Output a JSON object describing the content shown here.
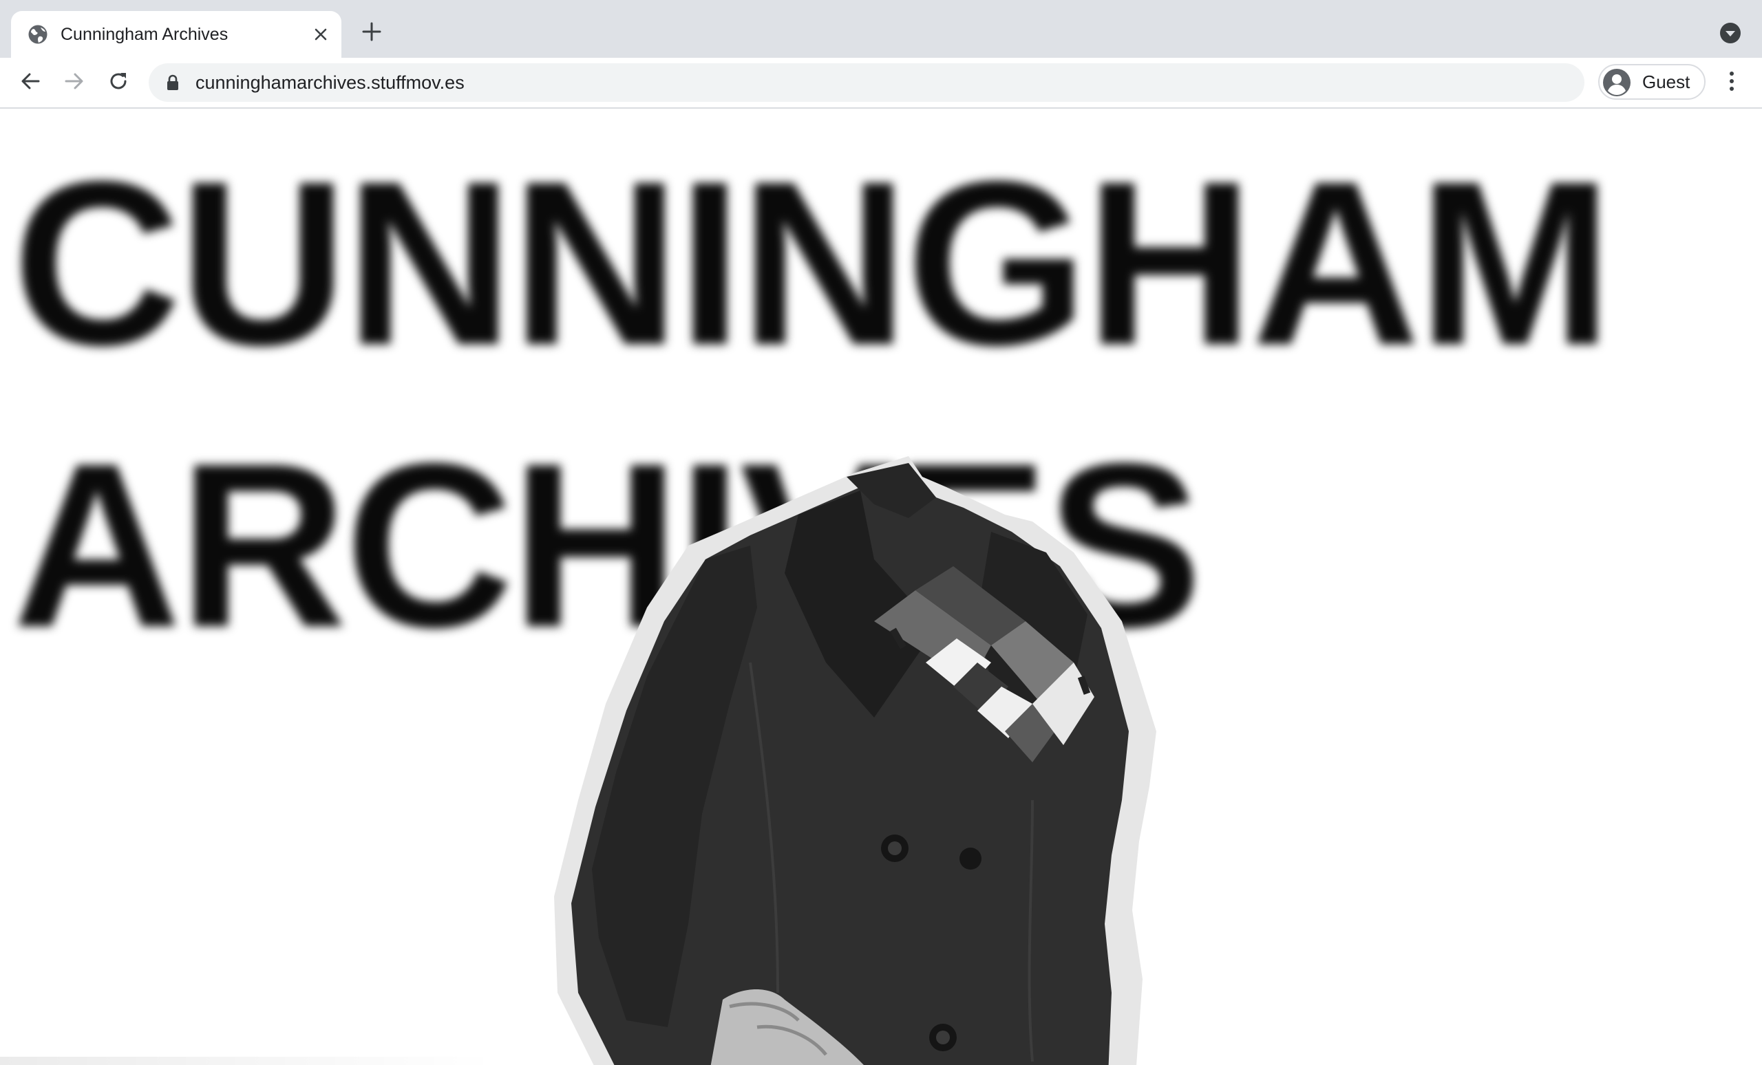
{
  "browser": {
    "tab": {
      "title": "Cunningham Archives",
      "favicon": "globe-icon"
    },
    "new_tab_icon": "plus-icon",
    "tab_search_icon": "chevron-down-circle-icon",
    "toolbar": {
      "back_icon": "arrow-left-icon",
      "forward_icon": "arrow-right-icon",
      "reload_icon": "reload-icon",
      "lock_icon": "lock-icon",
      "url": "cunninghamarchives.stuffmov.es",
      "profile_label": "Guest",
      "menu_icon": "three-dots-vertical-icon"
    }
  },
  "page": {
    "title_line_1": "CUNNINGHAM",
    "title_line_2": "ARCHIVES",
    "image": "black-and-white cutout photo of a headless figure in a dark double-breasted coat with a striped scarf"
  },
  "colors": {
    "tabstrip_bg": "#dee1e6",
    "omnibox_bg": "#f1f3f4",
    "text": "#202124",
    "title_text": "#0a0a0a",
    "page_bg": "#ffffff"
  }
}
